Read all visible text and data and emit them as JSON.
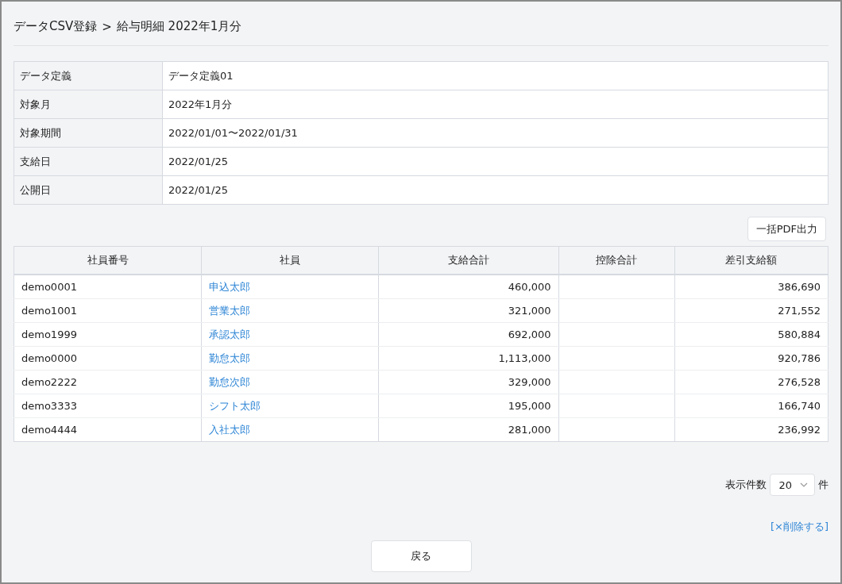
{
  "page_title": {
    "parent": "データCSV登録",
    "separator": ">",
    "current": "給与明細 2022年1月分"
  },
  "info": [
    {
      "label": "データ定義",
      "value": "データ定義01"
    },
    {
      "label": "対象月",
      "value": "2022年1月分"
    },
    {
      "label": "対象期間",
      "value": "2022/01/01〜2022/01/31"
    },
    {
      "label": "支給日",
      "value": "2022/01/25"
    },
    {
      "label": "公開日",
      "value": "2022/01/25"
    }
  ],
  "pdf_button": "一括PDF出力",
  "table": {
    "columns": [
      "社員番号",
      "社員",
      "支給合計",
      "控除合計",
      "差引支給額"
    ],
    "rows": [
      {
        "id": "demo0001",
        "name": "申込太郎",
        "pay_total": "460,000",
        "net_pay": "386,690"
      },
      {
        "id": "demo1001",
        "name": "営業太郎",
        "pay_total": "321,000",
        "net_pay": "271,552"
      },
      {
        "id": "demo1999",
        "name": "承認太郎",
        "pay_total": "692,000",
        "net_pay": "580,884"
      },
      {
        "id": "demo0000",
        "name": "勤怠太郎",
        "pay_total": "1,113,000",
        "net_pay": "920,786"
      },
      {
        "id": "demo2222",
        "name": "勤怠次郎",
        "pay_total": "329,000",
        "net_pay": "276,528"
      },
      {
        "id": "demo3333",
        "name": "シフト太郎",
        "pay_total": "195,000",
        "net_pay": "166,740"
      },
      {
        "id": "demo4444",
        "name": "入社太郎",
        "pay_total": "281,000",
        "net_pay": "236,992"
      }
    ]
  },
  "page_size": {
    "label": "表示件数",
    "value": "20",
    "unit": "件"
  },
  "delete_link": "[×削除する]",
  "back_button": "戻る"
}
